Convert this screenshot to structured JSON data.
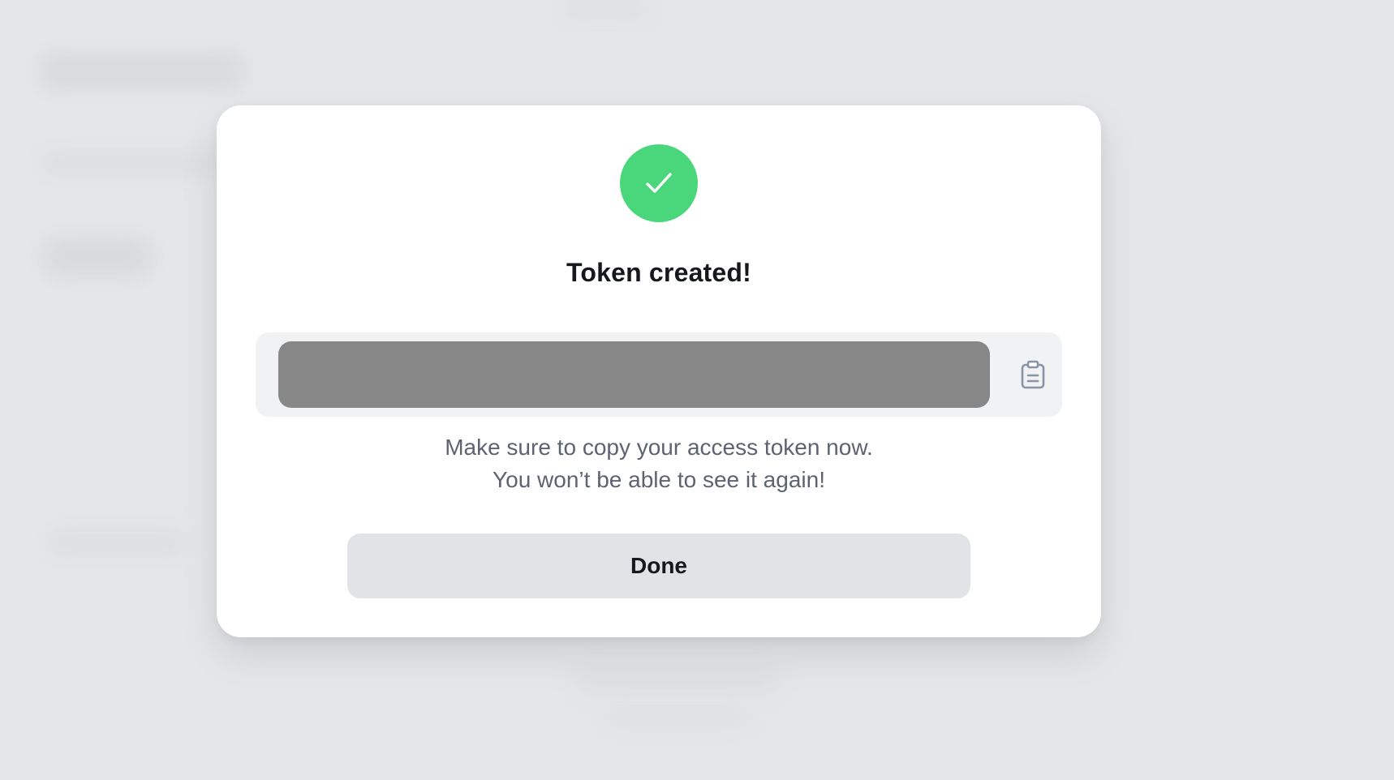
{
  "colors": {
    "page_background": "#e5e6e9",
    "modal_background": "#ffffff",
    "success_green": "#4ad77b",
    "token_mask": "#878787",
    "token_box_background": "#f1f2f4",
    "hint_text": "#5d6370",
    "done_button_background": "#e2e3e7",
    "title_text": "#16181d",
    "copy_icon": "#8a94a6"
  },
  "modal": {
    "status_icon": "checkmark-icon",
    "title": "Token created!",
    "token": {
      "value": "",
      "masked": true,
      "copy_icon": "clipboard-icon"
    },
    "hint_lines": [
      "Make sure to copy your access token now.",
      "You won’t be able to see it again!"
    ],
    "done_label": "Done"
  }
}
